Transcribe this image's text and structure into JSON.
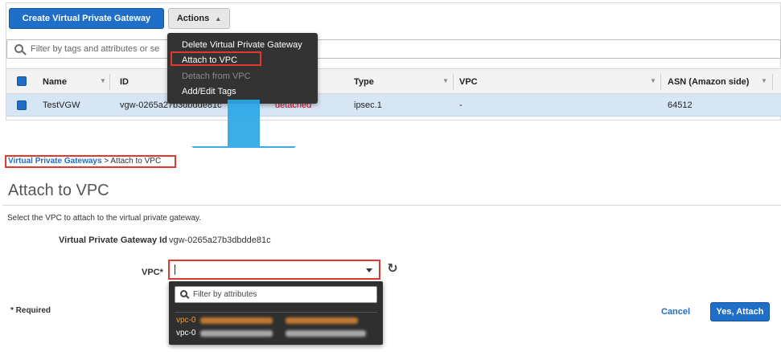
{
  "top": {
    "create_button": "Create Virtual Private Gateway",
    "actions_button": "Actions",
    "filter_placeholder": "Filter by tags and attributes or se",
    "columns": [
      "Name",
      "ID",
      "Type",
      "VPC",
      "ASN (Amazon side)"
    ],
    "row": {
      "name": "TestVGW",
      "id": "vgw-0265a27b3dbdde81c",
      "state": "detached",
      "type": "ipsec.1",
      "vpc": "-",
      "asn": "64512"
    },
    "actions_menu": [
      {
        "label": "Delete Virtual Private Gateway",
        "enabled": true
      },
      {
        "label": "Attach to VPC",
        "enabled": true,
        "highlighted": true
      },
      {
        "label": "Detach from VPC",
        "enabled": false
      },
      {
        "label": "Add/Edit Tags",
        "enabled": true
      }
    ]
  },
  "bottom": {
    "breadcrumb_link": "Virtual Private Gateways",
    "breadcrumb_current": " > Attach to VPC",
    "title": "Attach to VPC",
    "description": "Select the VPC to attach to the virtual private gateway.",
    "vgw_id_label": "Virtual Private Gateway Id",
    "vgw_id_value": "vgw-0265a27b3dbdde81c",
    "vpc_label": "VPC*",
    "vpc_filter_placeholder": "Filter by attributes",
    "vpc_options": [
      {
        "id": "vpc-0",
        "state": "selected"
      },
      {
        "id": "vpc-0",
        "state": "normal"
      }
    ],
    "required_note": "* Required",
    "cancel": "Cancel",
    "confirm": "Yes, Attach"
  },
  "colors": {
    "primary": "#1f6ec7",
    "highlight": "#e03a2f",
    "arrow": "#2aa7e6",
    "menu_bg": "#333333"
  }
}
